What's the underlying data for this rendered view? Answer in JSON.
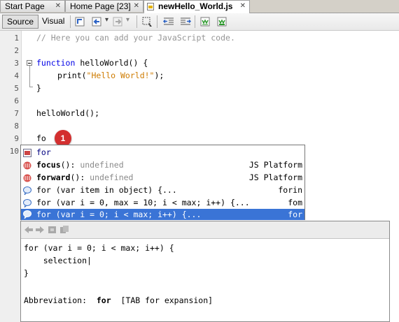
{
  "tabs": [
    {
      "label": "Start Page",
      "close": "✕"
    },
    {
      "label": "Home Page [23]",
      "close": "✕"
    },
    {
      "label": "newHello_World.js",
      "close": "✕"
    }
  ],
  "toolbar": {
    "source_label": "Source",
    "visual_label": "Visual",
    "dropdown_arrow": "▾"
  },
  "editor": {
    "line_numbers": [
      "1",
      "2",
      "3",
      "4",
      "5",
      "6",
      "7",
      "8",
      "9",
      "10"
    ],
    "line1_comment": "// Here you can add your JavaScript code.",
    "line3_keyword": "function",
    "line3_rest": " helloWorld() {",
    "line4_call": "print(",
    "line4_string": "\"Hello World!\"",
    "line4_end": ");",
    "line5": "}",
    "line7": "helloWorld();",
    "line9": "fo"
  },
  "badge": {
    "number": "1"
  },
  "completion": {
    "items": [
      {
        "name": "for",
        "suffix": "",
        "type": "",
        "source": ""
      },
      {
        "name": "focus",
        "suffix": "(): ",
        "type": "undefined",
        "source": "JS Platform"
      },
      {
        "name": "forward",
        "suffix": "(): ",
        "type": "undefined",
        "source": "JS Platform"
      },
      {
        "name": "for (var item in object) {...",
        "suffix": "",
        "type": "",
        "source": "forin"
      },
      {
        "name": "for (var i = 0, max = 10; i < max; i++) {...",
        "suffix": "",
        "type": "",
        "source": "fom"
      },
      {
        "name": "for (var i = 0; i < max; i++) {...",
        "suffix": "",
        "type": "",
        "source": "for"
      }
    ]
  },
  "doc": {
    "line1": "for (var i = 0; i < max; i++) {",
    "line2": "    selection|",
    "line3": "}",
    "abbrev_label": "Abbreviation:",
    "abbrev_value": "for",
    "abbrev_hint": "[TAB for expansion]"
  },
  "colors": {
    "keyword": "#0000e6",
    "string": "#ce7b00",
    "comment": "#969696",
    "selection": "#3a74d6",
    "badge": "#d32f2f"
  }
}
